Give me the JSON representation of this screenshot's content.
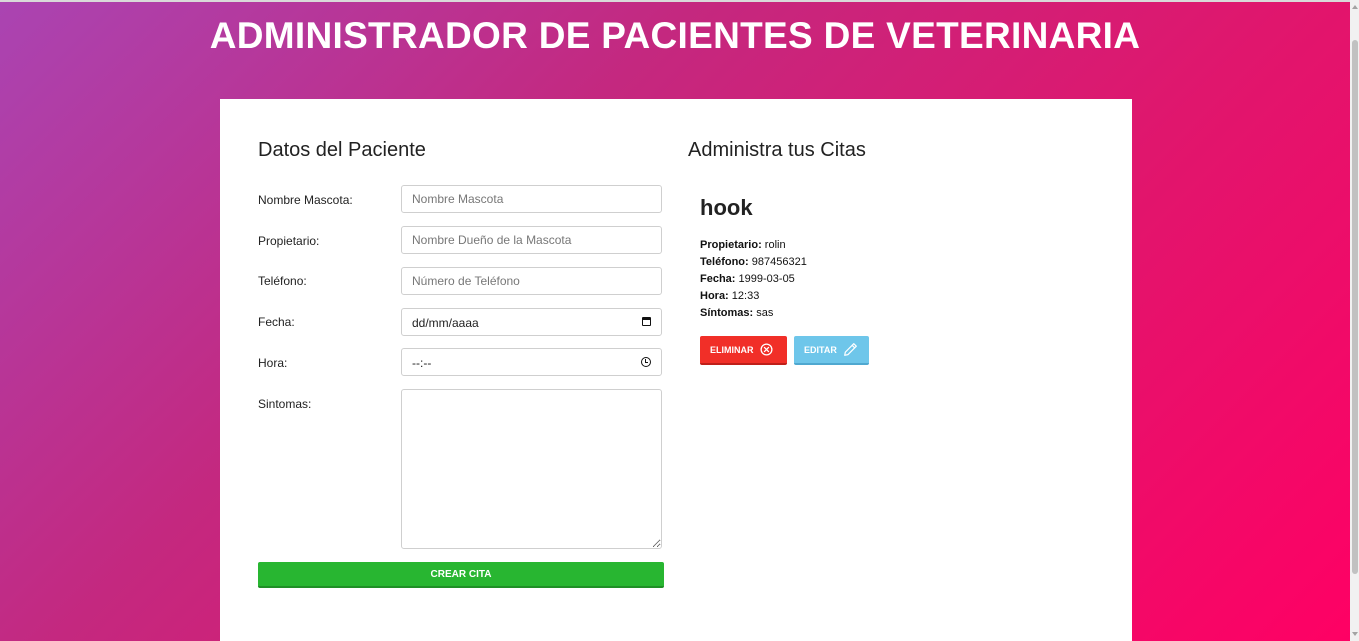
{
  "header": {
    "title": "ADMINISTRADOR DE PACIENTES DE VETERINARIA"
  },
  "form": {
    "title": "Datos del Paciente",
    "fields": {
      "mascota": {
        "label": "Nombre Mascota:",
        "placeholder": "Nombre Mascota",
        "value": ""
      },
      "propietario": {
        "label": "Propietario:",
        "placeholder": "Nombre Dueño de la Mascota",
        "value": ""
      },
      "telefono": {
        "label": "Teléfono:",
        "placeholder": "Número de Teléfono",
        "value": ""
      },
      "fecha": {
        "label": "Fecha:",
        "value": "dd/mm/aaaa",
        "icon": "calendar-icon"
      },
      "hora": {
        "label": "Hora:",
        "value": "--:--",
        "icon": "clock-icon"
      },
      "sintomas": {
        "label": "Sintomas:",
        "value": ""
      }
    },
    "submit_label": "CREAR CITA"
  },
  "citas": {
    "title": "Administra tus Citas",
    "items": [
      {
        "mascota": "hook",
        "propietario_label": "Propietario:",
        "propietario": "rolin",
        "telefono_label": "Teléfono:",
        "telefono": "987456321",
        "fecha_label": "Fecha:",
        "fecha": "1999-03-05",
        "hora_label": "Hora:",
        "hora": "12:33",
        "sintomas_label": "Síntomas:",
        "sintomas": "sas",
        "delete_label": "ELIMINAR",
        "delete_icon": "close-circle-icon",
        "edit_label": "EDITAR",
        "edit_icon": "pencil-icon"
      }
    ]
  },
  "colors": {
    "delete": "#f12f28",
    "edit": "#6ec6ea",
    "submit": "#28b631",
    "gradient_start": "#aa44b2",
    "gradient_end": "#ff0064"
  }
}
